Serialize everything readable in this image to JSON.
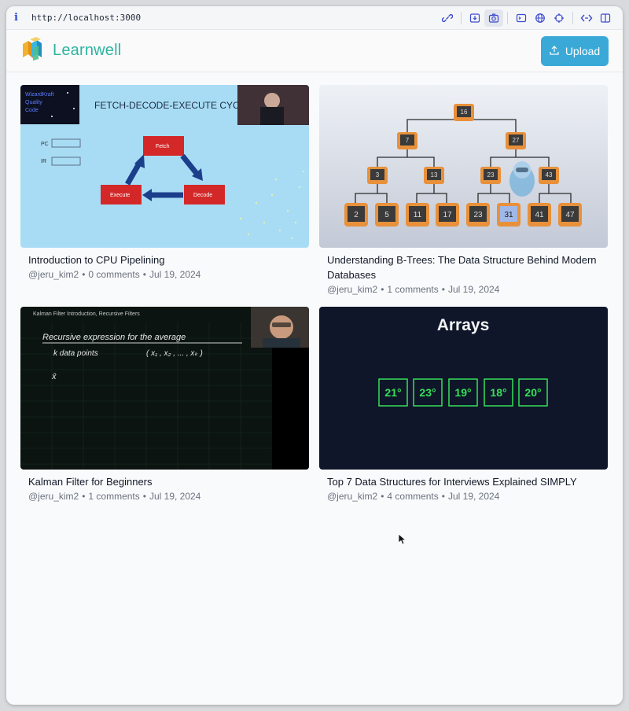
{
  "browser": {
    "url": "http://localhost:3000"
  },
  "header": {
    "brand": "Learnwell",
    "upload_label": "Upload"
  },
  "videos": [
    {
      "title": "Introduction to CPU Pipelining",
      "author": "@jeru_kim2",
      "comments": "0 comments",
      "date": "Jul 19, 2024",
      "thumb": {
        "heading": "FETCH-DECODE-EXECUTE CYCLE",
        "badge": [
          "WizardKraft",
          "Quality",
          "Code"
        ],
        "registers": [
          "PC",
          "IR"
        ],
        "steps": [
          "Fetch",
          "Decode",
          "Execute"
        ]
      }
    },
    {
      "title": "Understanding B-Trees: The Data Structure Behind Modern Databases",
      "author": "@jeru_kim2",
      "comments": "1 comments",
      "date": "Jul 19, 2024",
      "thumb": {
        "root": "16",
        "level1": [
          "7",
          "27"
        ],
        "level2": [
          "3",
          "13",
          "23",
          "43"
        ],
        "leaves": [
          "2",
          "5",
          "11",
          "17",
          "23",
          "31",
          "41",
          "47"
        ]
      }
    },
    {
      "title": "Kalman Filter for Beginners",
      "author": "@jeru_kim2",
      "comments": "1 comments",
      "date": "Jul 19, 2024",
      "thumb": {
        "heading": "Kalman Filter Introduction, Recursive Filters",
        "line1": "Recursive expression for the average",
        "line2": "k data points",
        "line3": "( x₁ , x₂ , ... , xₖ )",
        "line4": "x̄"
      }
    },
    {
      "title": "Top 7 Data Structures for Interviews Explained SIMPLY",
      "author": "@jeru_kim2",
      "comments": "4 comments",
      "date": "Jul 19, 2024",
      "thumb": {
        "heading": "Arrays",
        "cells": [
          "21°",
          "23°",
          "19°",
          "18°",
          "20°"
        ]
      }
    }
  ],
  "colors": {
    "brand": "#2db4a0",
    "upload": "#3aa9d8"
  }
}
